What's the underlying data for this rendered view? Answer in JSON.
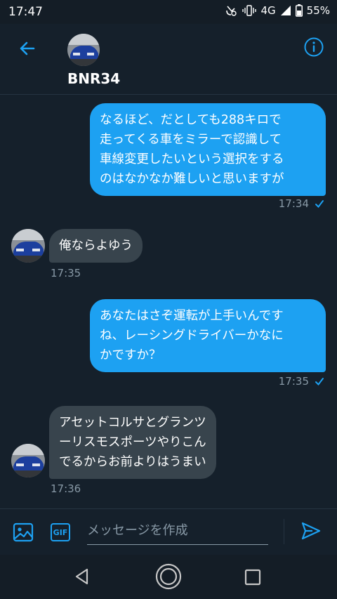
{
  "status_bar": {
    "time": "17:47",
    "network": "4G",
    "battery": "55%"
  },
  "header": {
    "contact_name": "BNR34"
  },
  "messages": [
    {
      "direction": "outgoing",
      "lines": [
        "なるほど、だとしても288キロで",
        "走ってくる車をミラーで認識して",
        "車線変更したいという選択をする",
        "のはなかなか難しいと思いますが"
      ],
      "time": "17:34"
    },
    {
      "direction": "incoming",
      "lines": [
        "俺ならよゆう"
      ],
      "time": "17:35"
    },
    {
      "direction": "outgoing",
      "lines": [
        "あなたはさぞ運転が上手いんです",
        "ね、レーシングドライバーかなに",
        "かですか？"
      ],
      "time": "17:35"
    },
    {
      "direction": "incoming",
      "lines": [
        "アセットコルサとグランツ",
        "ーリスモスポーツやりこん",
        "でるからお前よりはうまい"
      ],
      "time": "17:36"
    }
  ],
  "composer": {
    "placeholder": "メッセージを作成",
    "gif_label": "GIF"
  },
  "colors": {
    "background": "#15202b",
    "outgoing_bubble": "#1da1f2",
    "incoming_bubble": "#38444d",
    "accent": "#1da1f2",
    "muted_text": "#8899a6"
  }
}
